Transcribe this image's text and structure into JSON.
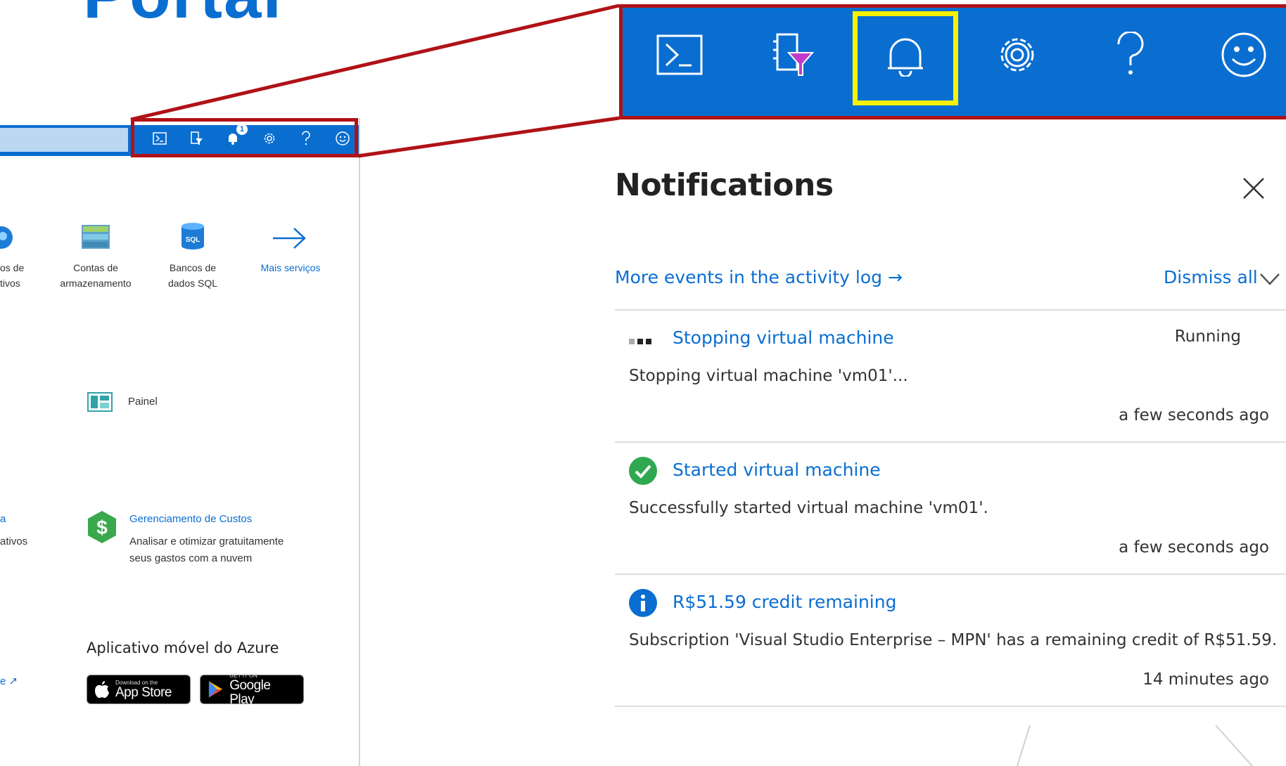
{
  "slide": {
    "title": "Portal"
  },
  "colors": {
    "azure_blue": "#0a6ed1",
    "highlight_red": "#b01216",
    "highlight_yellow": "#f7f200",
    "success_green": "#2fa84f"
  },
  "portal_preview": {
    "topbar_icons": [
      "cloud-shell-icon",
      "directory-filter-icon",
      "notifications-icon",
      "settings-icon",
      "help-icon",
      "feedback-icon"
    ],
    "notification_badge": "1",
    "services": [
      {
        "line1": "os de",
        "line2": "tivos",
        "icon": "globe-icon"
      },
      {
        "line1": "Contas de",
        "line2": "armazenamento",
        "icon": "storage-icon"
      },
      {
        "line1": "Bancos de",
        "line2": "dados SQL",
        "icon": "sql-database-icon"
      },
      {
        "line1": "Mais serviços",
        "line2": "",
        "icon": "arrow-right-icon"
      }
    ],
    "dashboard_label": "Painel",
    "cost": {
      "title": "Gerenciamento de Custos",
      "desc_line1": "Analisar e otimizar gratuitamente",
      "desc_line2": "seus gastos com a nuvem"
    },
    "left_cut": {
      "line1": "ativos",
      "line2": "a",
      "more": "e"
    },
    "mobile_app": {
      "heading": "Aplicativo móvel do Azure",
      "appstore_small": "Download on the",
      "appstore_big": "App Store",
      "googleplay_small": "GET IT ON",
      "googleplay_big": "Google Play"
    }
  },
  "topbar_icons": [
    "cloud-shell-icon",
    "directory-filter-icon",
    "notifications-icon",
    "settings-icon",
    "help-icon",
    "feedback-icon"
  ],
  "notifications": {
    "title": "Notifications",
    "activity_link": "More events in the activity log →",
    "dismiss_all": "Dismiss all",
    "items": [
      {
        "icon": "progress-dots-icon",
        "title": "Stopping virtual machine",
        "status": "Running",
        "desc": "Stopping virtual machine 'vm01'...",
        "time": "a few seconds ago"
      },
      {
        "icon": "success-check-icon",
        "title": "Started virtual machine",
        "desc": "Successfully started virtual machine 'vm01'.",
        "time": "a few seconds ago"
      },
      {
        "icon": "info-icon",
        "title": "R$51.59 credit remaining",
        "desc": "Subscription 'Visual Studio Enterprise – MPN' has a remaining credit of R$51.59.",
        "time": "14 minutes ago"
      }
    ]
  }
}
